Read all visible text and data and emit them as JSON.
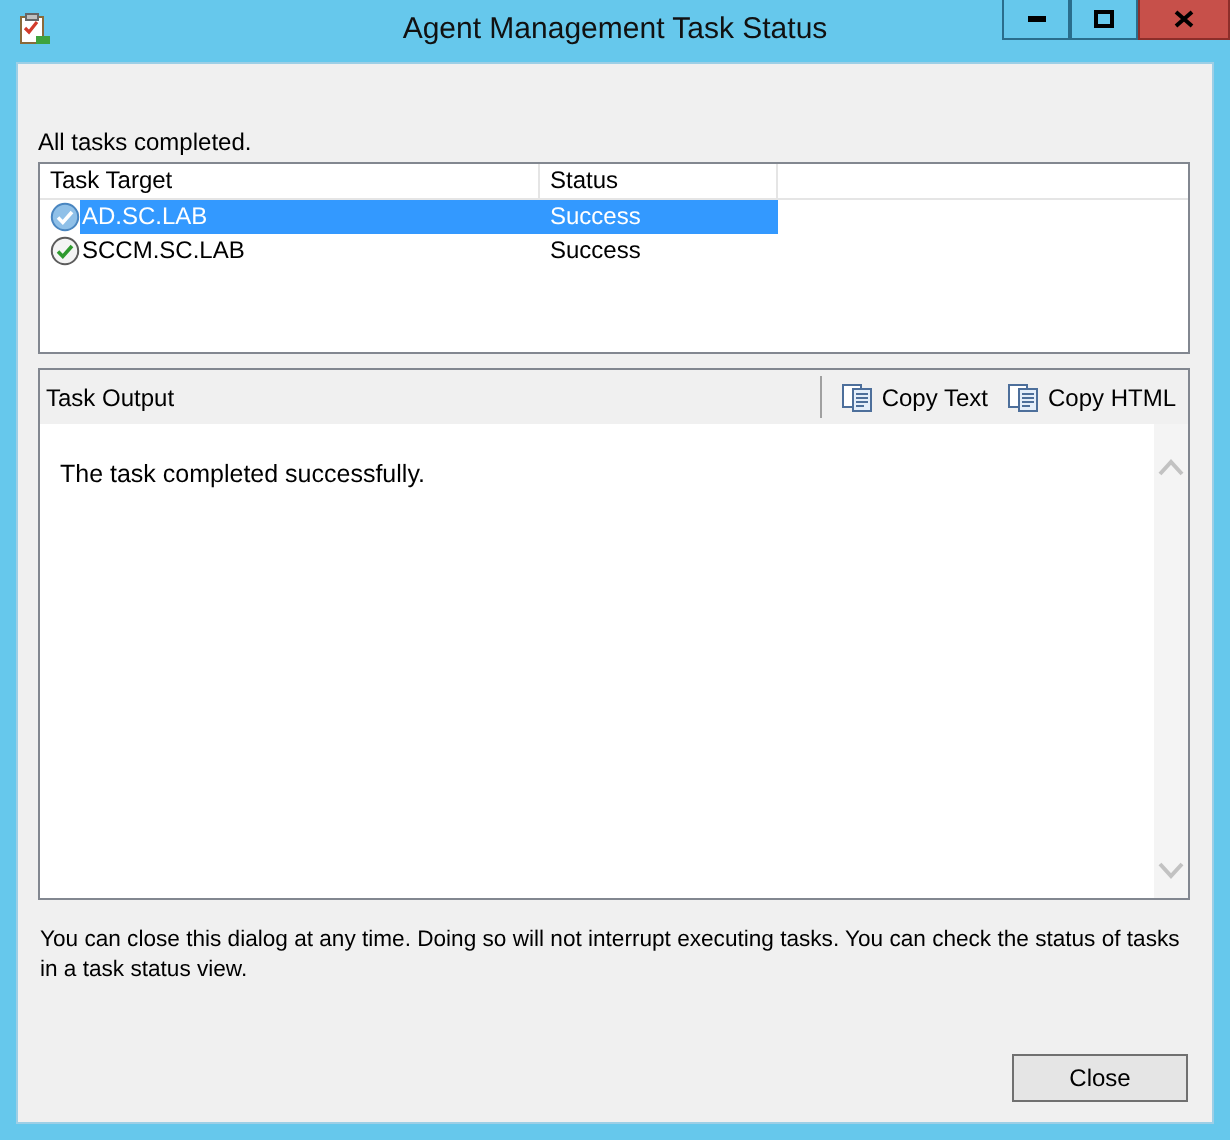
{
  "window": {
    "title": "Agent Management Task Status"
  },
  "summary": "All tasks completed.",
  "task_list": {
    "columns": [
      "Task Target",
      "Status"
    ],
    "rows": [
      {
        "target": "AD.SC.LAB",
        "status": "Success",
        "selected": true
      },
      {
        "target": "SCCM.SC.LAB",
        "status": "Success",
        "selected": false
      }
    ]
  },
  "task_output": {
    "title": "Task Output",
    "actions": [
      "Copy Text",
      "Copy HTML"
    ],
    "text": "The task completed successfully."
  },
  "note": "You can close this dialog at any time. Doing so will not interrupt executing tasks. You can check the status of tasks in a task status view.",
  "buttons": [
    "Close"
  ]
}
